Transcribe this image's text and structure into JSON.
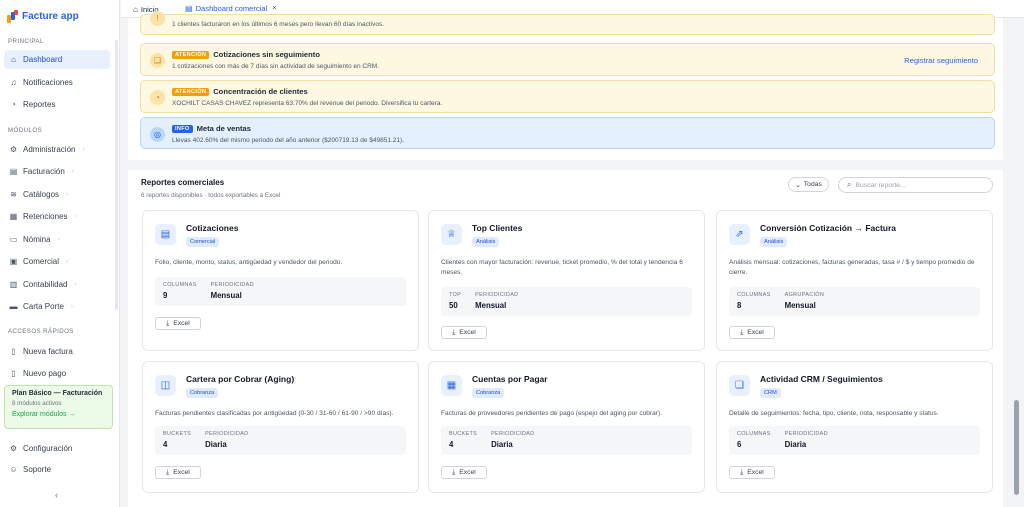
{
  "app": {
    "name": "Facture app"
  },
  "sidebar": {
    "sections": {
      "principal": "PRINCIPAL",
      "modulos": "MÓDULOS",
      "accesos": "ACCESOS RÁPIDOS"
    },
    "principal_items": [
      {
        "label": "Dashboard",
        "icon": "home-icon"
      },
      {
        "label": "Notificaciones",
        "icon": "bell-icon"
      },
      {
        "label": "Reportes",
        "icon": "chart-icon"
      }
    ],
    "modulo_items": [
      {
        "label": "Administración",
        "icon": "gear-icon"
      },
      {
        "label": "Facturación",
        "icon": "receipt-icon"
      },
      {
        "label": "Catálogos",
        "icon": "layers-icon"
      },
      {
        "label": "Retenciones",
        "icon": "stack-icon"
      },
      {
        "label": "Nómina",
        "icon": "id-card-icon"
      },
      {
        "label": "Comercial",
        "icon": "briefcase-icon"
      },
      {
        "label": "Contabilidad",
        "icon": "calculator-icon"
      },
      {
        "label": "Carta Porte",
        "icon": "truck-icon"
      }
    ],
    "acceso_items": [
      {
        "label": "Nueva factura",
        "icon": "document-icon"
      },
      {
        "label": "Nuevo pago",
        "icon": "payment-icon"
      }
    ],
    "plan": {
      "title": "Plan Básico — Facturación",
      "subtitle": "8 módulos activos",
      "link": "Explorar módulos →"
    },
    "footer_items": [
      {
        "label": "Configuración",
        "icon": "gear-icon"
      },
      {
        "label": "Soporte",
        "icon": "user-icon"
      }
    ],
    "collapse": "‹"
  },
  "tabs": [
    {
      "label": "Inicio",
      "icon": "home-icon"
    },
    {
      "label": "Dashboard comercial",
      "icon": "dashboard-icon",
      "close": "×"
    }
  ],
  "alerts": [
    {
      "desc": "1 clientes facturaron en los últimos 6 meses pero llevan 60 días inactivos."
    },
    {
      "badge": "ATENCIÓN",
      "title": "Cotizaciones sin seguimiento",
      "desc": "1 cotizaciones con más de 7 días sin actividad de seguimiento en CRM.",
      "action": "Registrar seguimiento"
    },
    {
      "badge": "ATENCIÓN",
      "title": "Concentración de clientes",
      "desc": "XOCHILT CASAS CHAVEZ representa 63.70% del revenue del periodo. Diversifica tu cartera."
    },
    {
      "badge": "INFO",
      "title": "Meta de ventas",
      "desc": "Llevas 402.60% del mismo periodo del año anterior ($200719.13 de $49851.21)."
    }
  ],
  "reports": {
    "title": "Reportes comerciales",
    "subtitle": "6 reportes disponibles · todos exportables a Excel",
    "filter": "Todas",
    "search_placeholder": "Buscar reporte...",
    "export_label": "Excel",
    "cards": [
      {
        "title": "Cotizaciones",
        "tag": "Comercial",
        "icon": "document-icon",
        "desc": "Folio, cliente, monto, status, antigüedad y vendedor del periodo.",
        "stats": [
          {
            "label": "COLUMNAS",
            "value": "9"
          },
          {
            "label": "PERIODICIDAD",
            "value": "Mensual"
          }
        ]
      },
      {
        "title": "Top Clientes",
        "tag": "Análisis",
        "icon": "trophy-icon",
        "desc": "Clientes con mayor facturación: revenue, ticket promedio, % del total y tendencia 6 meses.",
        "stats": [
          {
            "label": "TOP",
            "value": "50"
          },
          {
            "label": "PERIODICIDAD",
            "value": "Mensual"
          }
        ]
      },
      {
        "title": "Conversión Cotización → Factura",
        "tag": "Análisis",
        "icon": "convert-icon",
        "desc": "Análisis mensual: cotizaciones, facturas generadas, tasa # / $ y tiempo promedio de cierre.",
        "stats": [
          {
            "label": "COLUMNAS",
            "value": "8"
          },
          {
            "label": "AGRUPACIÓN",
            "value": "Mensual"
          }
        ]
      },
      {
        "title": "Cartera por Cobrar (Aging)",
        "tag": "Cobranza",
        "icon": "wallet-icon",
        "desc": "Facturas pendientes clasificadas por antigüedad (0-30 / 31-60 / 61-90 / >90 días).",
        "stats": [
          {
            "label": "BUCKETS",
            "value": "4"
          },
          {
            "label": "PERIODICIDAD",
            "value": "Diaria"
          }
        ]
      },
      {
        "title": "Cuentas por Pagar",
        "tag": "Cobranza",
        "icon": "invoice-icon",
        "desc": "Facturas de proveedores pendientes de pago (espejo del aging por cobrar).",
        "stats": [
          {
            "label": "BUCKETS",
            "value": "4"
          },
          {
            "label": "PERIODICIDAD",
            "value": "Diaria"
          }
        ]
      },
      {
        "title": "Actividad CRM / Seguimientos",
        "tag": "CRM",
        "icon": "chat-icon",
        "desc": "Detalle de seguimientos: fecha, tipo, cliente, nota, responsable y status.",
        "stats": [
          {
            "label": "COLUMNAS",
            "value": "6"
          },
          {
            "label": "PERIODICIDAD",
            "value": "Diaria"
          }
        ]
      }
    ]
  },
  "colors": {
    "accent": "#2563eb",
    "warning": "#f59e0b",
    "success": "#16a34a"
  }
}
